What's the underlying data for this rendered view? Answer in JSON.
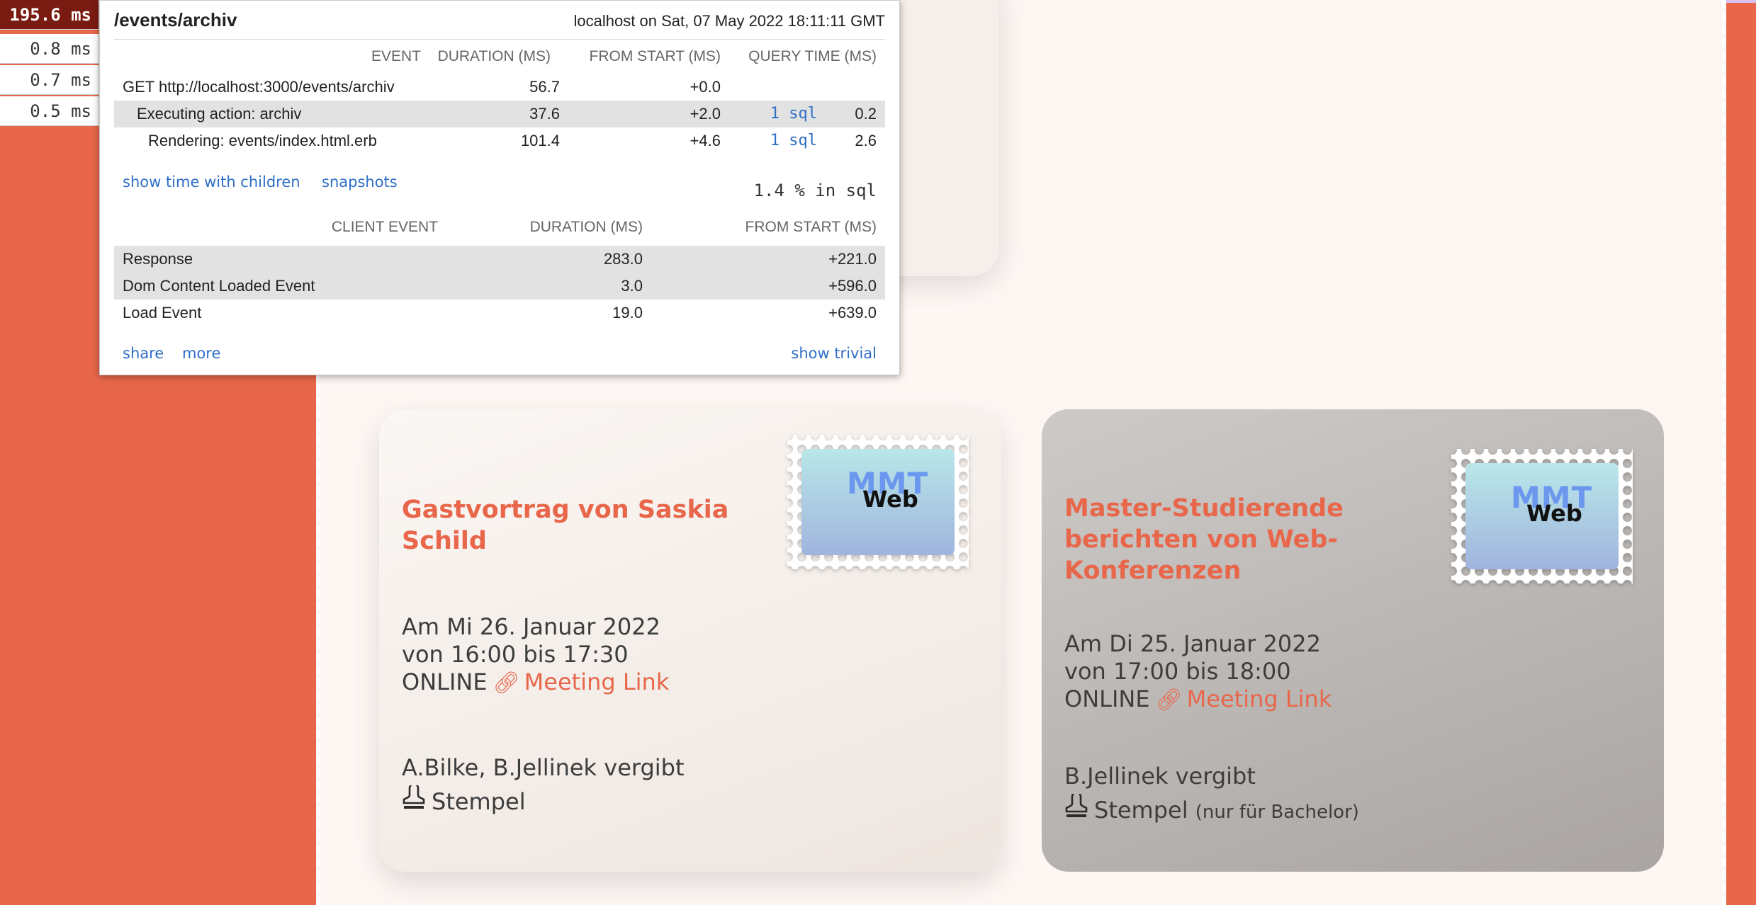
{
  "profiler": {
    "badges": [
      "195.6 ms",
      "0.8 ms",
      "0.7 ms",
      "0.5 ms"
    ],
    "title": "/events/archiv",
    "host_info": "localhost on Sat, 07 May 2022 18:11:11 GMT",
    "server_headers": [
      "EVENT",
      "DURATION (MS)",
      "FROM START (MS)",
      "QUERY TIME (MS)"
    ],
    "server_rows": [
      {
        "event": "GET http://localhost:3000/events/archiv",
        "duration": "56.7",
        "from_start": "+0.0",
        "sql": "",
        "query_time": ""
      },
      {
        "event": "Executing action: archiv",
        "duration": "37.6",
        "from_start": "+2.0",
        "sql": "1 sql",
        "query_time": "0.2"
      },
      {
        "event": "Rendering: events/index.html.erb",
        "duration": "101.4",
        "from_start": "+4.6",
        "sql": "1 sql",
        "query_time": "2.6"
      }
    ],
    "show_time_children": "show time with children",
    "snapshots": "snapshots",
    "sql_percent": "1.4 % in sql",
    "client_headers": [
      "CLIENT EVENT",
      "DURATION (MS)",
      "FROM START (MS)"
    ],
    "client_rows": [
      {
        "event": "Response",
        "duration": "283.0",
        "from_start": "+221.0"
      },
      {
        "event": "Dom Content Loaded Event",
        "duration": "3.0",
        "from_start": "+596.0"
      },
      {
        "event": "Load Event",
        "duration": "19.0",
        "from_start": "+639.0"
      }
    ],
    "share": "share",
    "more": "more",
    "show_trivial": "show trivial"
  },
  "events": [
    {
      "title": "Gastvortrag von Saskia Schild",
      "date": "Am Mi 26. Januar 2022",
      "time": "von 16:00 bis 17:30",
      "location": "ONLINE",
      "link_label": "Meeting Link",
      "hosts": "A.Bilke, B.Jellinek vergibt",
      "stamp_label": "Stempel",
      "stamp_note": "",
      "logo_top": "MMT",
      "logo_bottom": "Web"
    },
    {
      "title": "Master-Studierende berichten von Web-Konferenzen",
      "date": "Am Di 25. Januar 2022",
      "time": "von 17:00 bis 18:00",
      "location": "ONLINE",
      "link_label": "Meeting Link",
      "hosts": "B.Jellinek vergibt",
      "stamp_label": "Stempel",
      "stamp_note": "(nur für Bachelor)",
      "logo_top": "MMT",
      "logo_bottom": "Web"
    }
  ],
  "colors": {
    "accent": "#e8674b",
    "paper": "#fdf6f3",
    "profiler_link": "#2f6fc6",
    "badge_active": "#7a1b11"
  }
}
